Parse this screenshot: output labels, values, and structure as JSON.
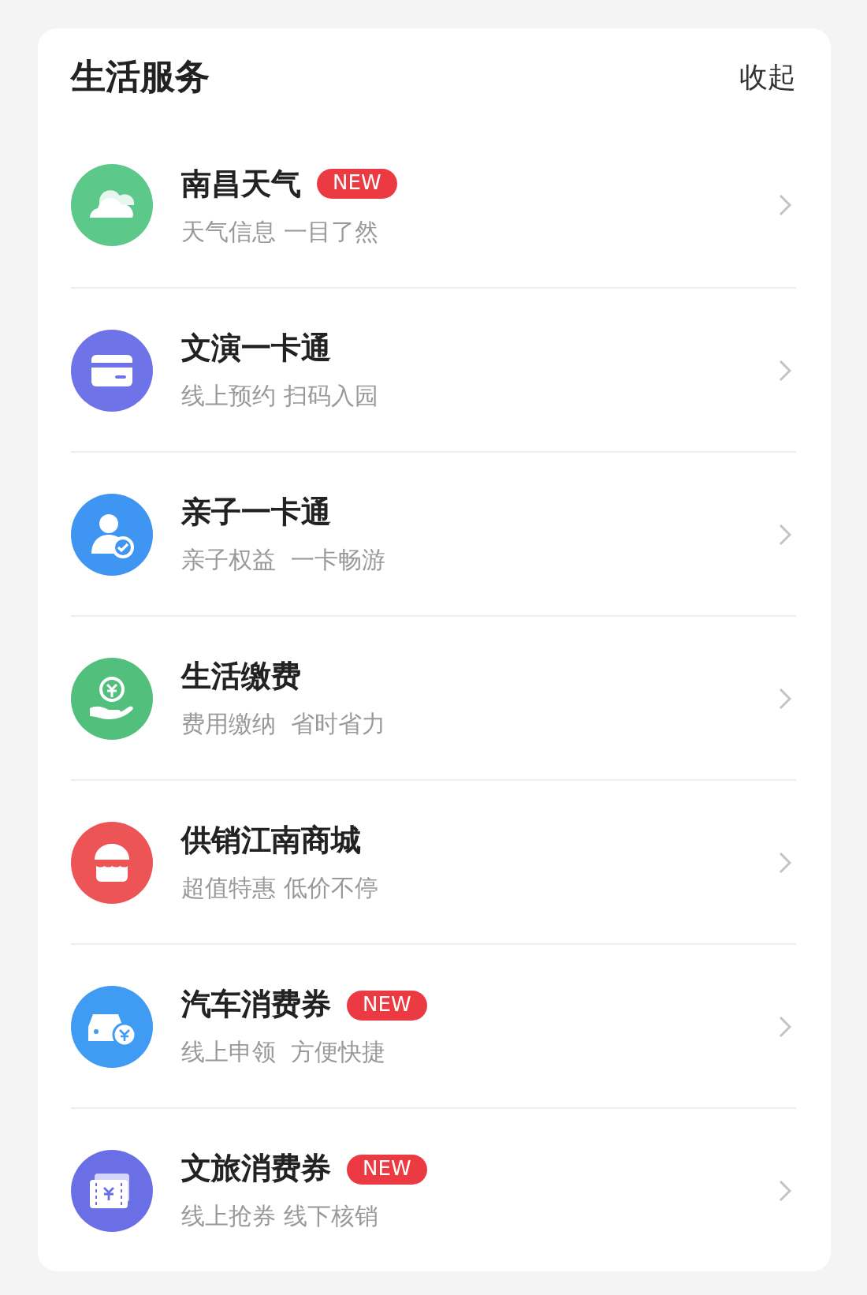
{
  "section": {
    "title": "生活服务",
    "action": "收起"
  },
  "items": [
    {
      "title": "南昌天气",
      "badge": "NEW",
      "subtitle": "天气信息 一目了然",
      "kind": "cloud",
      "color": "#5cc98a"
    },
    {
      "title": "文演一卡通",
      "subtitle": "线上预约 扫码入园",
      "kind": "card",
      "color": "#6f73e8"
    },
    {
      "title": "亲子一卡通",
      "subtitle": "亲子权益  一卡畅游",
      "kind": "person",
      "color": "#3f95f2"
    },
    {
      "title": "生活缴费",
      "subtitle": "费用缴纳  省时省力",
      "kind": "hand",
      "color": "#52c07c"
    },
    {
      "title": "供销江南商城",
      "subtitle": "超值特惠 低价不停",
      "kind": "shop",
      "color": "#ec5456"
    },
    {
      "title": "汽车消费券",
      "badge": "NEW",
      "subtitle": "线上申领  方便快捷",
      "kind": "car",
      "color": "#3f9cf2"
    },
    {
      "title": "文旅消费券",
      "badge": "NEW",
      "subtitle": "线上抢券 线下核销",
      "kind": "ticket",
      "color": "#6a6fe6"
    }
  ]
}
